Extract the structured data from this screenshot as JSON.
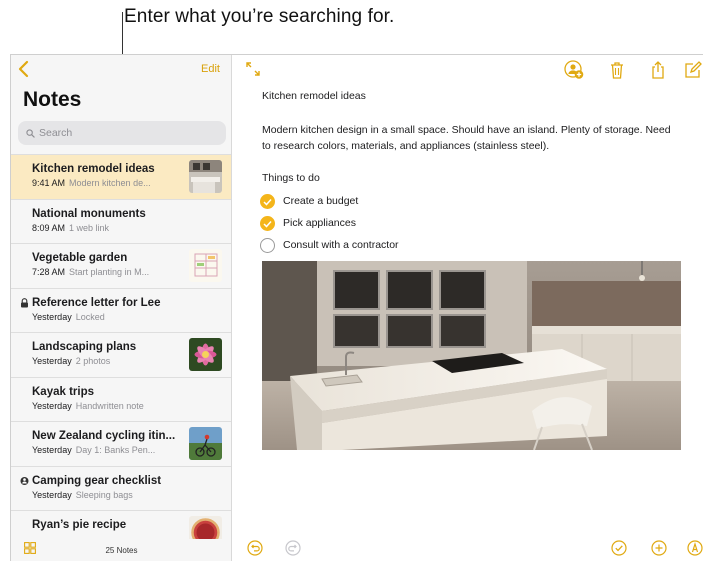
{
  "callout": {
    "text": "Enter what you’re searching for."
  },
  "sidebar": {
    "edit_label": "Edit",
    "title": "Notes",
    "search_placeholder": "Search",
    "notes_count": "25 Notes",
    "items": [
      {
        "title": "Kitchen remodel ideas",
        "time": "9:41 AM",
        "snippet": "Modern kitchen de...",
        "selected": true,
        "thumb": "kitchen"
      },
      {
        "title": "National monuments",
        "time": "8:09 AM",
        "snippet": "1 web link"
      },
      {
        "title": "Vegetable garden",
        "time": "7:28 AM",
        "snippet": "Start planting in M...",
        "thumb": "garden-sketch"
      },
      {
        "title": "Reference letter for Lee",
        "time": "Yesterday",
        "snippet": "Locked",
        "prefix": "lock-icon"
      },
      {
        "title": "Landscaping plans",
        "time": "Yesterday",
        "snippet": "2 photos",
        "thumb": "flower"
      },
      {
        "title": "Kayak trips",
        "time": "Yesterday",
        "snippet": "Handwritten note"
      },
      {
        "title": "New Zealand cycling itin...",
        "time": "Yesterday",
        "snippet": "Day 1: Banks Pen...",
        "thumb": "cyclist"
      },
      {
        "title": "Camping gear checklist",
        "time": "Yesterday",
        "snippet": "Sleeping bags",
        "prefix": "shared-icon"
      },
      {
        "title": "Ryan’s pie recipe",
        "time": "",
        "snippet": "",
        "thumb": "pie"
      }
    ]
  },
  "note": {
    "title": "Kitchen remodel ideas",
    "body": "Modern kitchen design in a small space. Should have an island. Plenty of storage. Need to research colors, materials, and appliances (stainless steel).",
    "todo_heading": "Things to do",
    "todos": [
      {
        "label": "Create a budget",
        "done": true
      },
      {
        "label": "Pick appliances",
        "done": true
      },
      {
        "label": "Consult with a contractor",
        "done": false
      }
    ]
  },
  "colors": {
    "accent": "#f4b51a",
    "accent_text": "#d9a10b",
    "selected_row": "#fbeac2",
    "sidebar_bg": "#f6f6f6"
  }
}
